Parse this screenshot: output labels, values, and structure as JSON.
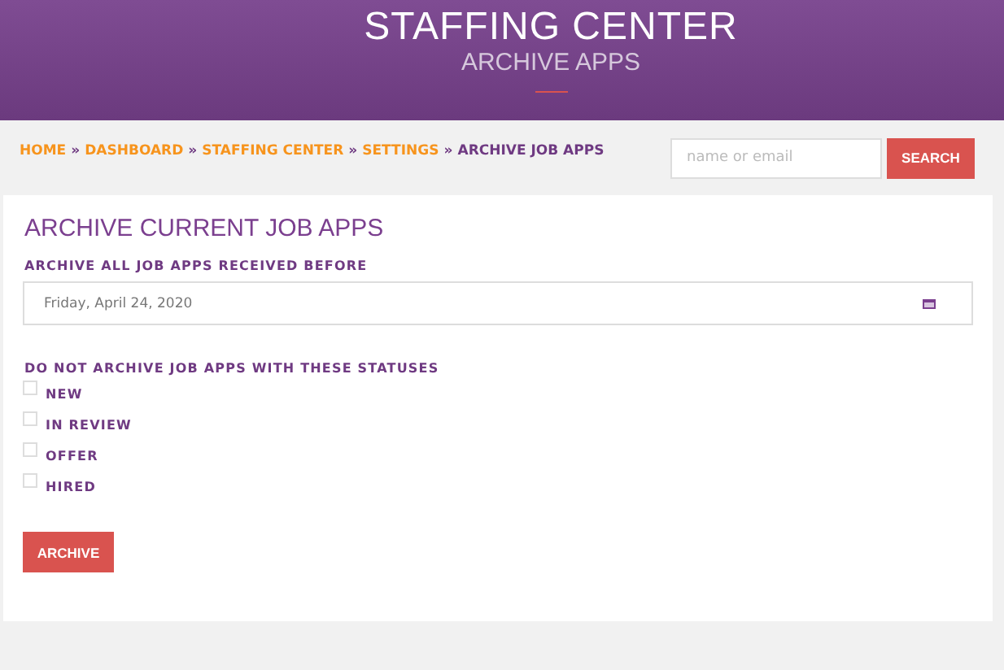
{
  "header": {
    "title": "STAFFING CENTER",
    "subtitle": "ARCHIVE APPS"
  },
  "breadcrumb": [
    {
      "kind": "link",
      "text": "HOME"
    },
    {
      "kind": "separator",
      "text": "»"
    },
    {
      "kind": "link",
      "text": "DASHBOARD"
    },
    {
      "kind": "separator",
      "text": "»"
    },
    {
      "kind": "link",
      "text": "STAFFING CENTER"
    },
    {
      "kind": "separator",
      "text": "»"
    },
    {
      "kind": "link",
      "text": "SETTINGS"
    },
    {
      "kind": "separator",
      "text": "»"
    },
    {
      "kind": "current",
      "text": "ARCHIVE JOB APPS"
    }
  ],
  "search": {
    "placeholder": "name or email",
    "button": "SEARCH"
  },
  "form": {
    "title": "ARCHIVE CURRENT JOB APPS",
    "date_label": "ARCHIVE ALL JOB APPS RECEIVED BEFORE",
    "date_value": "Friday, April 24, 2020",
    "status_label": "DO NOT ARCHIVE JOB APPS WITH THESE STATUSES",
    "statuses": [
      {
        "label": "NEW",
        "checked": false
      },
      {
        "label": "IN REVIEW",
        "checked": false
      },
      {
        "label": "OFFER",
        "checked": false
      },
      {
        "label": "HIRED",
        "checked": false
      }
    ],
    "button": "ARCHIVE"
  }
}
